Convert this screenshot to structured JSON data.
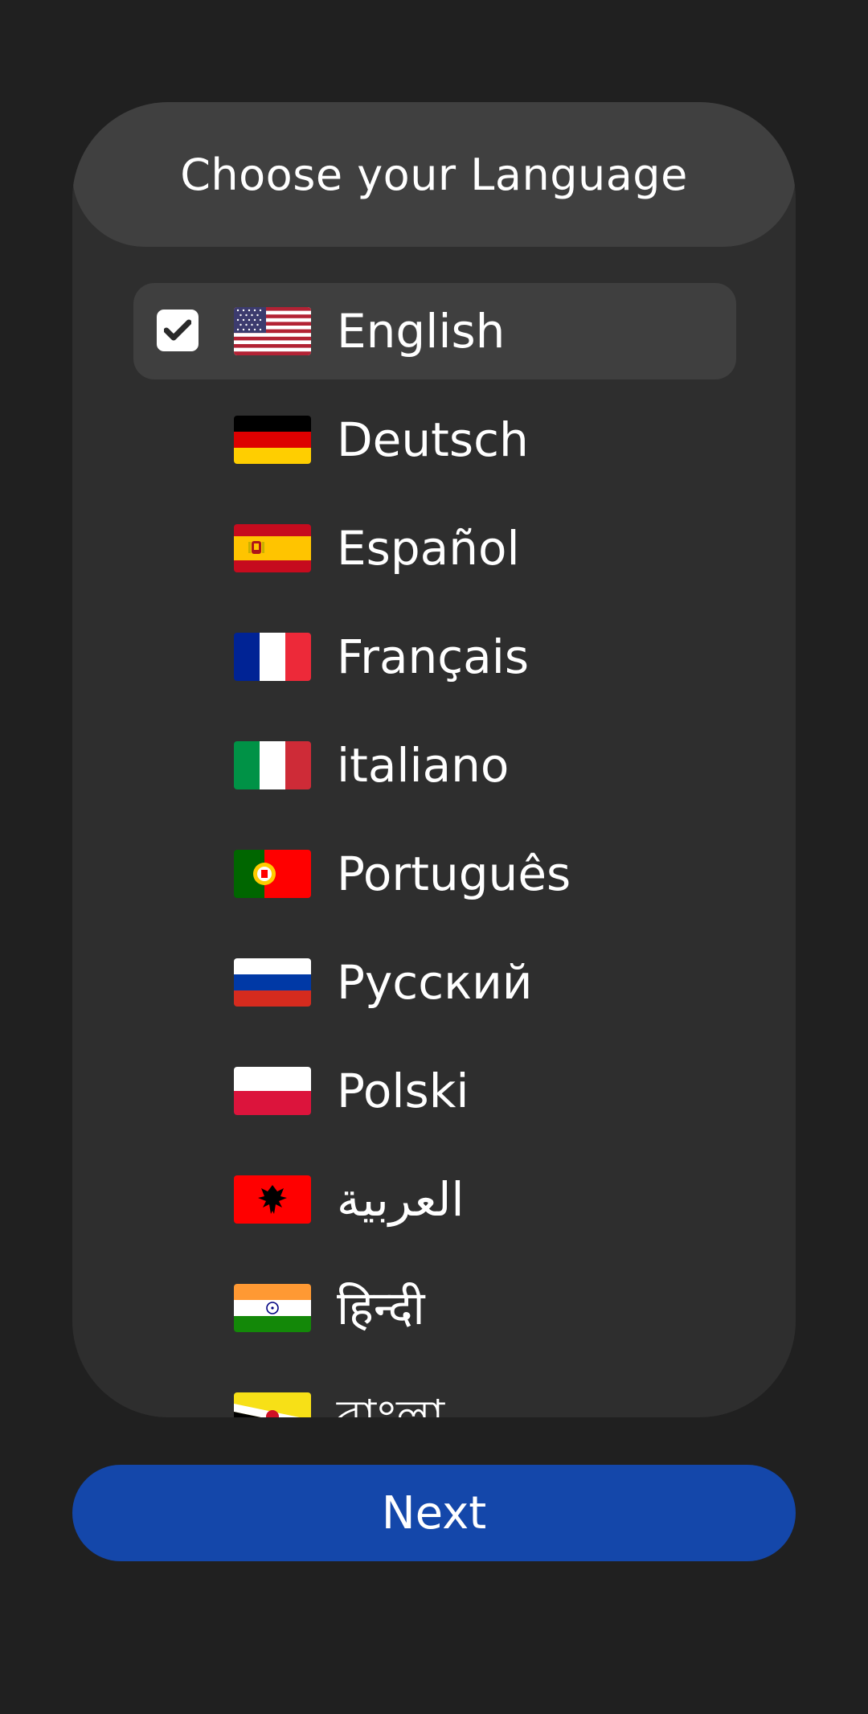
{
  "header": {
    "title": "Choose your Language"
  },
  "languages": [
    {
      "label": "English",
      "selected": true,
      "flag": "us-flag-icon"
    },
    {
      "label": "Deutsch",
      "flag": "de-flag-icon"
    },
    {
      "label": "Español",
      "flag": "es-flag-icon"
    },
    {
      "label": "Français",
      "flag": "fr-flag-icon"
    },
    {
      "label": "italiano",
      "flag": "it-flag-icon"
    },
    {
      "label": "Português",
      "flag": "pt-flag-icon"
    },
    {
      "label": "Русский",
      "flag": "ru-flag-icon"
    },
    {
      "label": "Polski",
      "flag": "pl-flag-icon"
    },
    {
      "label": "العربية",
      "flag": "al-flag-icon"
    },
    {
      "label": "हिन्दी",
      "flag": "in-flag-icon"
    },
    {
      "label": "বাংলা",
      "flag": "bn-flag-icon"
    }
  ],
  "next_button": {
    "label": "Next"
  },
  "colors": {
    "background": "#202020",
    "card": "#2e2e2e",
    "header": "#404040",
    "selected_row": "#3f3f3f",
    "accent": "#1447aa"
  }
}
